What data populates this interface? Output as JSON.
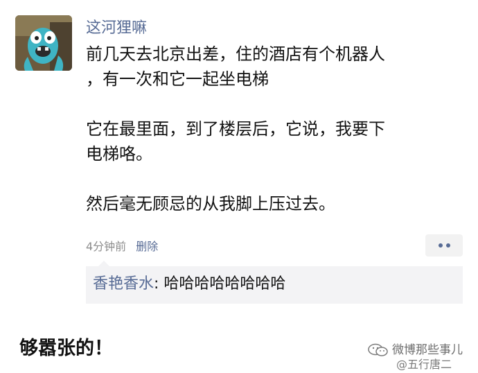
{
  "post": {
    "username": "这河狸嘛",
    "paragraphs": [
      [
        "前几天去北京出差，住的酒店有个机器人",
        "，有一次和它一起坐电梯"
      ],
      [
        "它在最里面，到了楼层后，它说，我要下",
        "电梯咯。"
      ],
      [
        "然后毫无顾忌的从我脚上压过去。"
      ]
    ],
    "time": "4分钟前",
    "delete_label": "删除",
    "more_icon": "more-dots-icon"
  },
  "comment": {
    "author": "香艳香水",
    "separator": ": ",
    "text": "哈哈哈哈哈哈哈哈"
  },
  "caption": "够嚣张的！",
  "watermark": {
    "icon": "wechat-icon",
    "source": "微博那些事儿",
    "handle": "@五行唐二"
  },
  "colors": {
    "link": "#576b95",
    "text": "#111111",
    "meta": "#8c8c8c",
    "comment_bg": "#f3f3f5",
    "button_bg": "#f2f2f2"
  }
}
